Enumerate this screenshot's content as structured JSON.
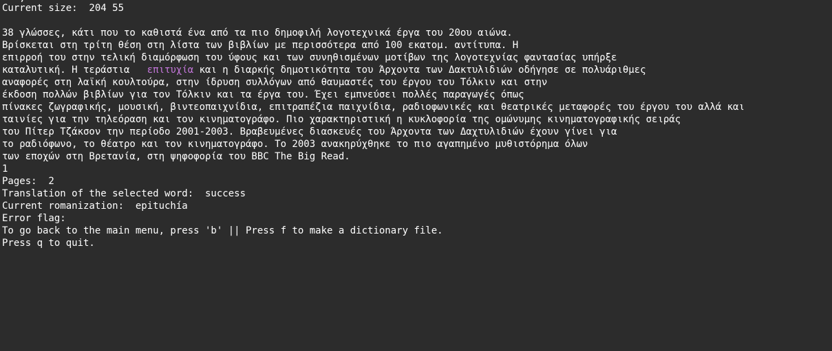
{
  "terminal": {
    "top_clipped": "   ,",
    "current_size_label": "Current size:  204 55",
    "text_lines": [
      "38 γλώσσες, κάτι που το καθιστά ένα από τα πιο δημοφιλή λογοτεχνικά έργα του 20ου αιώνα.",
      "Βρίσκεται στη τρίτη θέση στη λίστα των βιβλίων με περισσότερα από 100 εκατομ. αντίτυπα. Η",
      "επιρροή του στην τελική διαμόρφωση του ύφους και των συνηθισμένων μοτίβων της λογοτεχνίας φαντασίας υπήρξε"
    ],
    "highlight_line": {
      "before": "καταλυτική. Η τεράστια   ",
      "word": "επιτυχία",
      "after": " και η διαρκής δημοτικότητα του Άρχοντα των Δακτυλιδιών οδήγησε σε πολυάριθμες"
    },
    "text_lines_after": [
      "αναφορές στη λαϊκή κουλτούρα, στην ίδρυση συλλόγων από θαυμαστές του έργου του Τόλκιν και στην",
      "έκδοση πολλών βιβλίων για τον Τόλκιν και τα έργα του. Έχει εμπνεύσει πολλές παραγωγές όπως",
      "πίνακες ζωγραφικής, μουσική, βιντεοπαιχνίδια, επιτραπέζια παιχνίδια, ραδιοφωνικές και θεατρικές μεταφορές του έργου του αλλά και",
      "ταινίες για την τηλεόραση και τον κινηματογράφο. Πιο χαρακτηριστική η κυκλοφορία της ομώνυμης κινηματογραφικής σειράς",
      "του Πίτερ Τζάκσον την περίοδο 2001-2003. Βραβευμένες διασκευές του Άρχοντα των Δαχτυλιδιών έχουν γίνει για",
      "το ραδιόφωνο, το θέατρο και τον κινηματογράφο. Το 2003 ανακηρύχθηκε το πιο αγαπημένο μυθιστόρημα όλων",
      "των εποχών στη Βρετανία, στη ψηφοφορία του BBC The Big Read."
    ],
    "page_number": "1",
    "pages_line": "Pages:  2",
    "translation_line": "Translation of the selected word:  success",
    "romanization_line": "Current romanization:  epituchía",
    "error_flag_line": "Error flag:",
    "menu_hint_line": "To go back to the main menu, press 'b' || Press f to make a dictionary file.",
    "quit_hint_line": "Press q to quit.",
    "colors": {
      "background": "#2c2c2c",
      "text": "#ffffff",
      "highlight": "#c678dd"
    }
  }
}
